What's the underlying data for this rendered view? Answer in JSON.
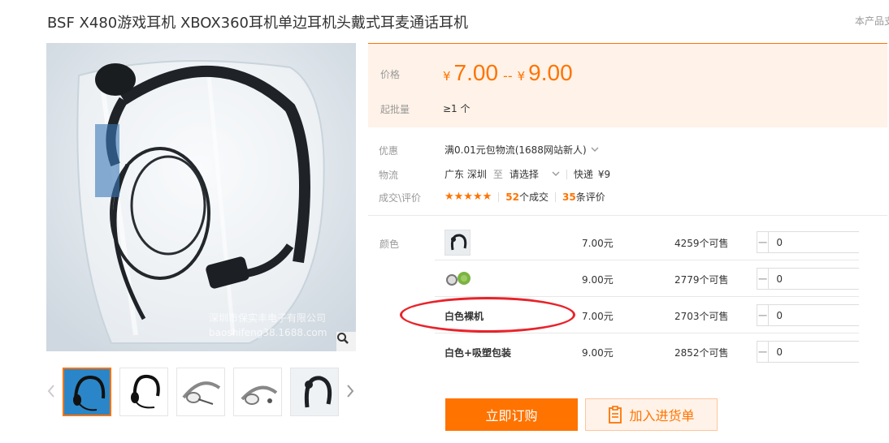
{
  "product": {
    "title": "BSF X480游戏耳机 XBOX360耳机单边耳机头戴式耳麦通话耳机",
    "corner_note": "本产品支"
  },
  "gallery": {
    "watermark_line1": "深圳市保实丰电子有限公司",
    "watermark_line2": "baoshifeng38.1688.com",
    "zoom_icon": "magnifier-icon",
    "prev_icon": "chevron-left-icon",
    "next_icon": "chevron-right-icon",
    "thumbnail_count": 5
  },
  "price": {
    "label": "价格",
    "currency": "¥",
    "min": "7.00",
    "range_sep": "--",
    "max": "9.00",
    "moq_label": "起批量",
    "moq_value": "≥1 个"
  },
  "promo": {
    "label": "优惠",
    "text": "满0.01元包物流(1688网站新人)"
  },
  "shipping": {
    "label": "物流",
    "from": "广东 深圳",
    "to_word": "至",
    "destination_placeholder": "请选择",
    "method": "快递",
    "fee": "¥9"
  },
  "deals": {
    "label": "成交\\评价",
    "rating": 5,
    "stars_text": "★★★★★",
    "orders_count": "52",
    "orders_suffix": "个成交",
    "reviews_count": "35",
    "reviews_suffix": "条评价"
  },
  "variants": {
    "label": "颜色",
    "items": [
      {
        "name": "",
        "has_image": true,
        "price": "7.00元",
        "stock": "4259个可售",
        "qty": "0"
      },
      {
        "name": "",
        "has_image": true,
        "price": "9.00元",
        "stock": "2779个可售",
        "qty": "0"
      },
      {
        "name": "白色裸机",
        "has_image": false,
        "price": "7.00元",
        "stock": "2703个可售",
        "qty": "0"
      },
      {
        "name": "白色+吸塑包装",
        "has_image": false,
        "price": "9.00元",
        "stock": "2852个可售",
        "qty": "0"
      }
    ],
    "minus": "−",
    "plus": "+"
  },
  "actions": {
    "buy_label": "立即订购",
    "cart_label": "加入进货单"
  },
  "colors": {
    "accent": "#ff7300",
    "price_bg": "#fff2e8",
    "annotation_red": "#e8232a"
  }
}
